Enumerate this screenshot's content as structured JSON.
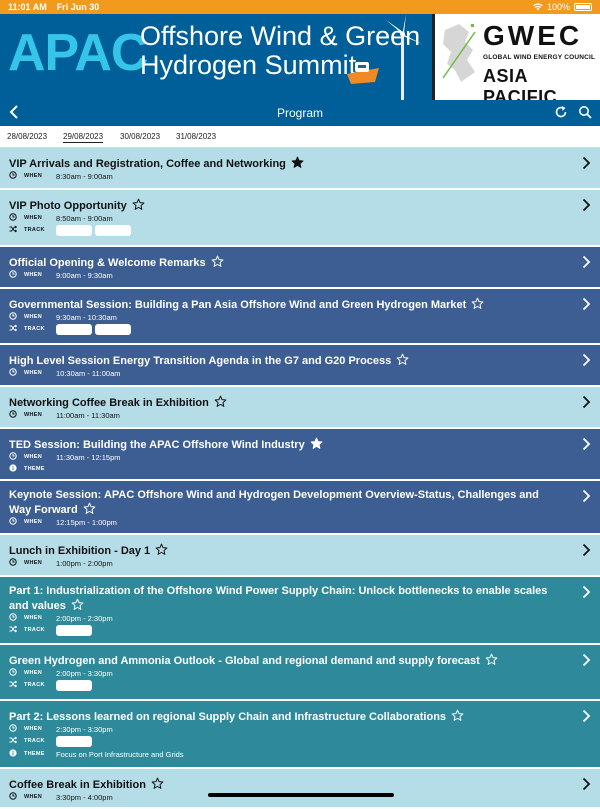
{
  "status": {
    "time": "11:01 AM",
    "date": "Fri Jun 30",
    "battery": "100%"
  },
  "banner": {
    "apac": "APAC",
    "title_line1": "Offshore Wind & Green",
    "title_line2": "Hydrogen Summit",
    "logo_main": "GWEC",
    "logo_sub": "GLOBAL WIND ENERGY COUNCIL",
    "logo_region": "ASIA PACIFIC"
  },
  "nav": {
    "title": "Program"
  },
  "dates": [
    "28/08/2023",
    "29/08/2023",
    "30/08/2023",
    "31/08/2023"
  ],
  "selected_date": "29/08/2023",
  "labels": {
    "when": "WHEN",
    "track": "TRACK",
    "theme": "THEME"
  },
  "sessions": [
    {
      "title": "VIP Arrivals and Registration, Coffee and Networking",
      "when": "8:30am - 9:00am",
      "starred": true,
      "style": "light"
    },
    {
      "title": "VIP Photo Opportunity",
      "when": "8:50am - 9:00am",
      "track_pills": 2,
      "starred": false,
      "style": "light"
    },
    {
      "title": "Official Opening & Welcome Remarks",
      "when": "9:00am - 9:30am",
      "starred": false,
      "style": "dark"
    },
    {
      "title": "Governmental Session: Building a Pan Asia Offshore Wind and Green Hydrogen Market",
      "when": "9:30am - 10:30am",
      "track_pills": 2,
      "starred": false,
      "style": "dark"
    },
    {
      "title": "High Level Session Energy Transition Agenda in the G7 and G20 Process",
      "when": "10:30am - 11:00am",
      "starred": false,
      "style": "dark"
    },
    {
      "title": "Networking Coffee Break in Exhibition",
      "when": "11:00am - 11:30am",
      "starred": false,
      "style": "light"
    },
    {
      "title": "TED Session: Building the APAC Offshore Wind Industry",
      "when": "11:30am - 12:15pm",
      "theme": "",
      "starred": true,
      "style": "dark"
    },
    {
      "title": "Keynote Session: APAC Offshore Wind and Hydrogen Development Overview-Status, Challenges and Way Forward",
      "when": "12:15pm - 1:00pm",
      "starred": false,
      "style": "dark"
    },
    {
      "title": "Lunch in Exhibition - Day 1",
      "when": "1:00pm - 2:00pm",
      "starred": false,
      "style": "light"
    },
    {
      "title": "Part 1: Industrialization of the Offshore Wind Power Supply Chain: Unlock bottlenecks to enable scales and values",
      "when": "2:00pm - 2:30pm",
      "track_pills": 1,
      "starred": false,
      "style": "teal"
    },
    {
      "title": "Green Hydrogen and Ammonia Outlook - Global and regional demand and supply forecast",
      "when": "2:00pm - 3:30pm",
      "track_pills": 1,
      "starred": false,
      "style": "teal"
    },
    {
      "title": "Part 2: Lessons learned on regional Supply Chain and Infrastructure Collaborations",
      "when": "2:30pm - 3:30pm",
      "track_pills": 1,
      "theme": "Focus on Port Infrastructure and Grids",
      "starred": false,
      "style": "teal"
    },
    {
      "title": "Coffee Break in Exhibition",
      "when": "3:30pm - 4:00pm",
      "starred": false,
      "style": "light"
    }
  ],
  "colors": {
    "status": "#f29a1e",
    "header": "#005f99",
    "light_row": "#b5dde8",
    "dark_row": "#3d5e92",
    "teal_row": "#2e8a9b",
    "accent": "#35c5e8"
  },
  "icons": {
    "back": "chevron-left-icon",
    "refresh": "refresh-icon",
    "search": "search-icon",
    "when": "clock-icon",
    "track": "shuffle-icon",
    "theme": "info-icon",
    "favorite": "star-icon",
    "open": "chevron-right-icon"
  }
}
